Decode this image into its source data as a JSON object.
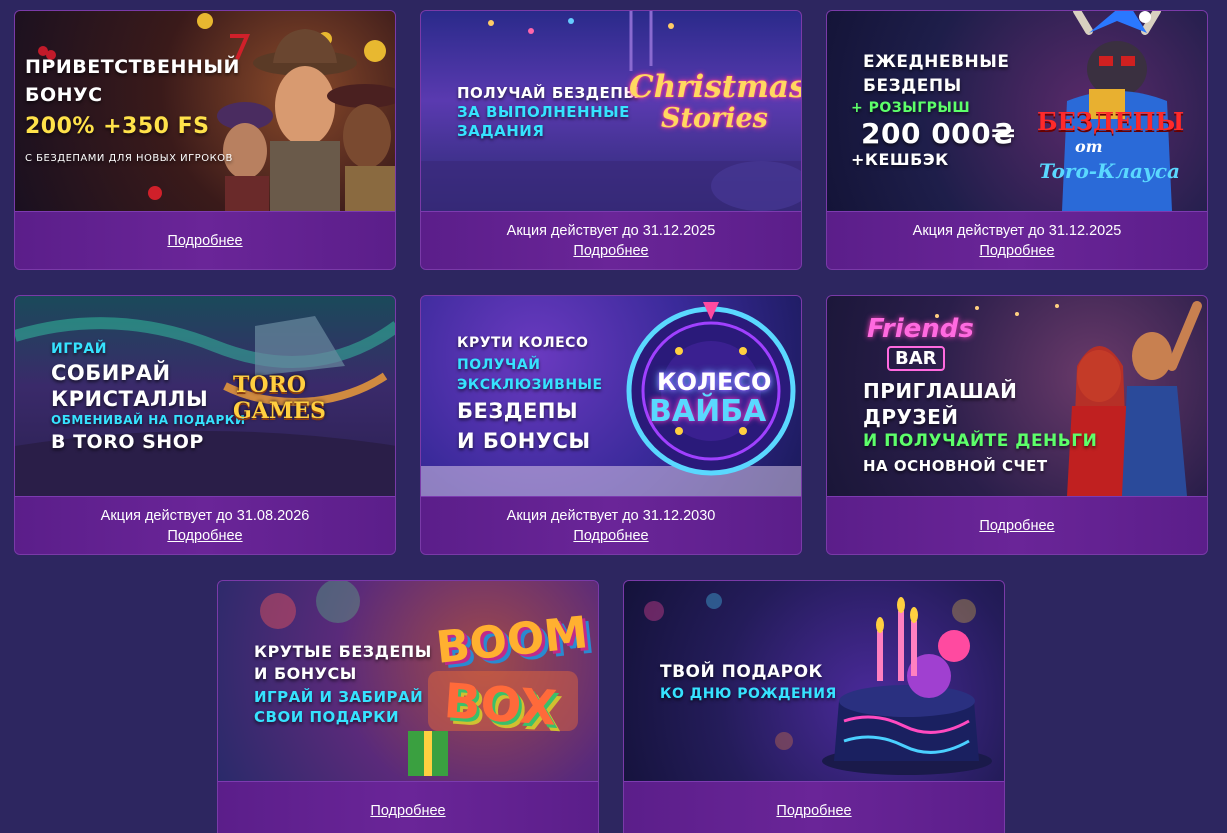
{
  "colors": {
    "page_bg": "#2d2660",
    "card_footer": "#5b1e8a",
    "accent_cyan": "#36e3ff",
    "accent_yellow": "#ffe24a",
    "accent_green": "#5dff6a"
  },
  "promos": [
    {
      "banner_lines": [
        "ПРИВЕТСТВЕННЫЙ",
        "БОНУС",
        "200% +350 FS",
        "С БЕЗДЕПАМИ ДЛЯ НОВЫХ ИГРОКОВ"
      ],
      "date_text": "",
      "link_text": "Подробнее"
    },
    {
      "banner_lines": [
        "ПОЛУЧАЙ БЕЗДЕПЫ",
        "ЗА ВЫПОЛНЕННЫЕ",
        "ЗАДАНИЯ"
      ],
      "logo": [
        "Christmas",
        "Stories"
      ],
      "date_text": "Акция действует до 31.12.2025",
      "link_text": "Подробнее"
    },
    {
      "banner_lines": [
        "ЕЖЕДНЕВНЫЕ",
        "БЕЗДЕПЫ",
        "+ РОЗЫГРЫШ",
        "200 000₴",
        "+КЕШБЭК"
      ],
      "logo": [
        "БЕЗДЕПЫ",
        "от",
        "Toro-Клауса"
      ],
      "date_text": "Акция действует до 31.12.2025",
      "link_text": "Подробнее"
    },
    {
      "banner_lines": [
        "ИГРАЙ",
        "СОБИРАЙ",
        "КРИСТАЛЛЫ",
        "ОБМЕНИВАЙ НА ПОДАРКИ",
        "В TORO SHOP"
      ],
      "logo": [
        "TORO GAMES"
      ],
      "date_text": "Акция действует до 31.08.2026",
      "link_text": "Подробнее"
    },
    {
      "banner_lines": [
        "КРУТИ КОЛЕСО",
        "ПОЛУЧАЙ",
        "ЭКСКЛЮЗИВНЫЕ",
        "БЕЗДЕПЫ",
        "И БОНУСЫ"
      ],
      "logo": [
        "КОЛЕСО",
        "ВАЙБА"
      ],
      "date_text": "Акция действует до 31.12.2030",
      "link_text": "Подробнее"
    },
    {
      "banner_lines": [
        "ПРИГЛАШАЙ",
        "ДРУЗЕЙ",
        "И ПОЛУЧАЙТЕ ДЕНЬГИ",
        "НА ОСНОВНОЙ СЧЕТ"
      ],
      "logo": [
        "Friends",
        "BAR"
      ],
      "date_text": "",
      "link_text": "Подробнее"
    },
    {
      "banner_lines": [
        "КРУТЫЕ БЕЗДЕПЫ",
        "И БОНУСЫ",
        "ИГРАЙ И ЗАБИРАЙ",
        "СВОИ ПОДАРКИ"
      ],
      "logo": [
        "BOOM",
        "BOX"
      ],
      "date_text": "",
      "link_text": "Подробнее"
    },
    {
      "banner_lines": [
        "ТВОЙ ПОДАРОК",
        "КО ДНЮ РОЖДЕНИЯ"
      ],
      "date_text": "",
      "link_text": "Подробнее"
    }
  ]
}
